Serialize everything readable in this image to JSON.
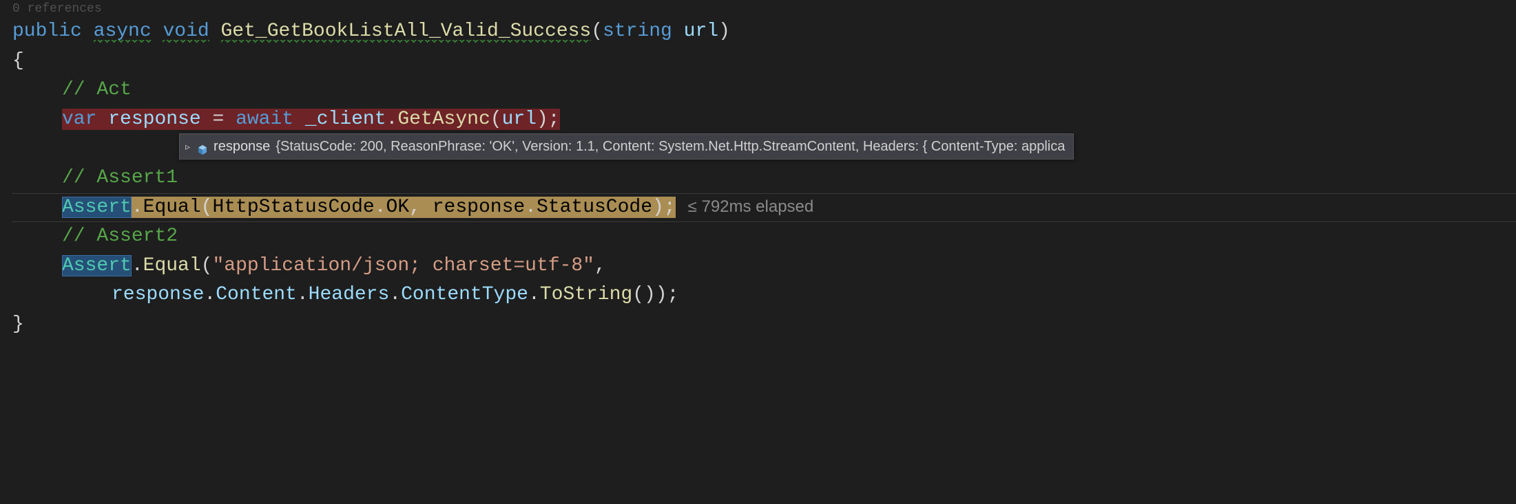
{
  "references_label": "0 references",
  "method": {
    "modifiers": [
      "public",
      "async",
      "void"
    ],
    "name": "Get_GetBookListAll_Valid_Success",
    "param_type": "string",
    "param_name": "url"
  },
  "comments": {
    "act": "// Act",
    "assert1": "// Assert1",
    "assert2": "// Assert2"
  },
  "act_line": {
    "var_kw": "var",
    "var_name": "response",
    "eq": " = ",
    "await_kw": "await",
    "target": "_client",
    "method": "GetAsync",
    "arg": "url"
  },
  "datatip": {
    "var": "response",
    "value": "{StatusCode: 200, ReasonPhrase: 'OK', Version: 1.1, Content: System.Net.Http.StreamContent, Headers: {  Content-Type: applica"
  },
  "assert1_line": {
    "class": "Assert",
    "method": "Equal",
    "arg1_type": "HttpStatusCode",
    "arg1_member": "OK",
    "arg2_obj": "response",
    "arg2_member": "StatusCode"
  },
  "perf_tip": "≤ 792ms elapsed",
  "assert2_line": {
    "class": "Assert",
    "method": "Equal",
    "string_arg": "\"application/json; charset=utf-8\"",
    "line2": "response.Content.Headers.ContentType.ToString());"
  },
  "icons": {
    "expander": "▹",
    "variable": "cube"
  }
}
